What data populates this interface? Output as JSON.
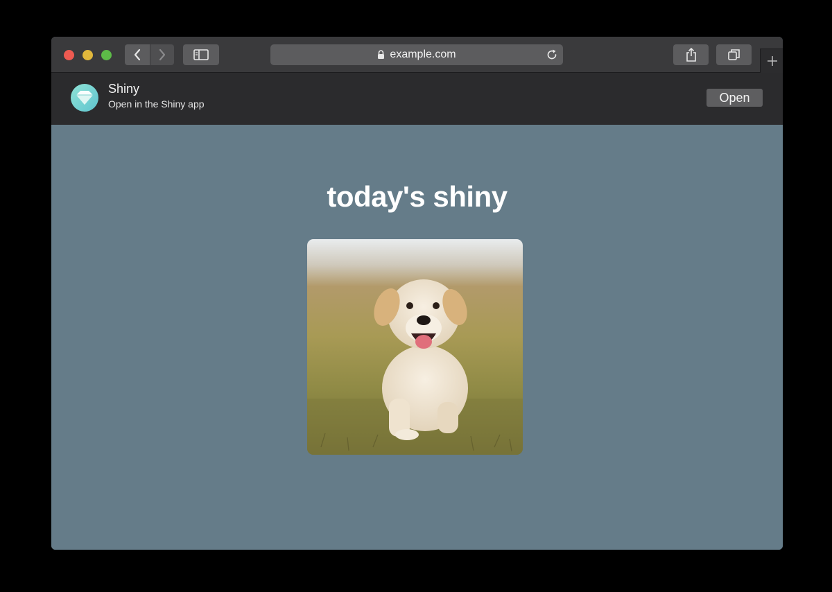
{
  "browser": {
    "url": "example.com",
    "icons": {
      "back": "chevron-left-icon",
      "forward": "chevron-right-icon",
      "sidebar": "sidebar-icon",
      "lock": "lock-icon",
      "reload": "reload-icon",
      "share": "share-icon",
      "tabs": "tabs-overview-icon",
      "new_tab": "plus-icon"
    }
  },
  "smart_banner": {
    "app_name": "Shiny",
    "subtitle": "Open in the Shiny app",
    "open_label": "Open"
  },
  "page": {
    "heading": "today's shiny",
    "image_subject": "golden retriever puppy running on grass"
  },
  "colors": {
    "page_background": "#657c89",
    "toolbar": "#3a3a3c",
    "banner": "#2b2b2d",
    "close": "#ee5a51",
    "minimize": "#e0b73c",
    "zoom": "#5dbb48"
  }
}
